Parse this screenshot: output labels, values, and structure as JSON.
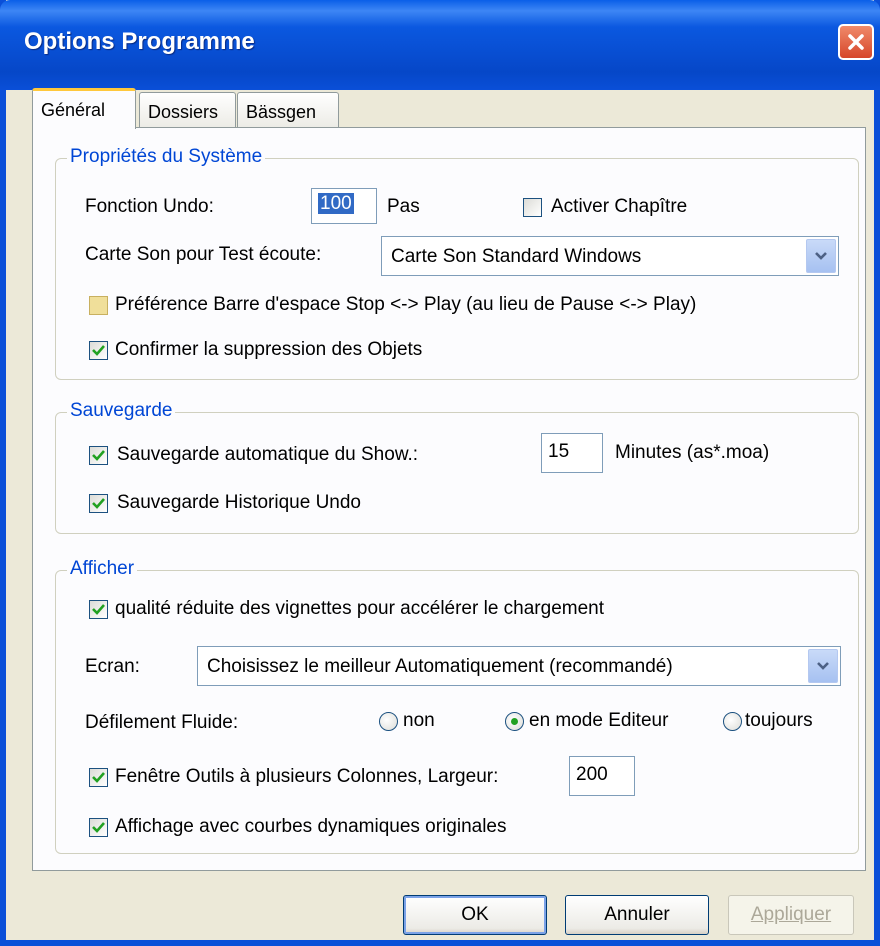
{
  "window": {
    "title": "Options Programme"
  },
  "tabs": [
    {
      "label": "Général",
      "active": true
    },
    {
      "label": "Dossiers",
      "active": false
    },
    {
      "label": "Bässgen",
      "active": false
    }
  ],
  "system": {
    "legend": "Propriétés du Système",
    "undo_label": "Fonction Undo:",
    "undo_value": "100",
    "undo_unit": "Pas",
    "chapter_label": "Activer Chapître",
    "chapter_checked": false,
    "sound_label": "Carte Son pour Test écoute:",
    "sound_value": "Carte Son Standard Windows",
    "spacebar_label": "Préférence Barre d'espace Stop <-> Play (au lieu de Pause <-> Play)",
    "spacebar_checked": false,
    "confirm_label": "Confirmer la suppression des Objets",
    "confirm_checked": true
  },
  "backup": {
    "legend": "Sauvegarde",
    "auto_label": "Sauvegarde automatique du Show.:",
    "auto_checked": true,
    "auto_value": "15",
    "auto_unit": "Minutes (as*.moa)",
    "history_label": "Sauvegarde Historique Undo",
    "history_checked": true
  },
  "display": {
    "legend": "Afficher",
    "thumb_label": "qualité réduite des vignettes pour accélérer le chargement",
    "thumb_checked": true,
    "screen_label": "Ecran:",
    "screen_value": "Choisissez le meilleur Automatiquement (recommandé)",
    "scroll_label": "Défilement Fluide:",
    "scroll_options": [
      {
        "label": "non",
        "selected": false
      },
      {
        "label": "en mode Editeur",
        "selected": true
      },
      {
        "label": "toujours",
        "selected": false
      }
    ],
    "tools_label": "Fenêtre Outils à plusieurs Colonnes, Largeur:",
    "tools_checked": true,
    "tools_value": "200",
    "curves_label": "Affichage avec courbes dynamiques originales",
    "curves_checked": true
  },
  "buttons": {
    "ok": "OK",
    "cancel": "Annuler",
    "apply": "Appliquer"
  },
  "colors": {
    "titlebar": "#0a4fd8",
    "legend": "#0046d5",
    "check": "#21a121",
    "close": "#d6462a"
  }
}
